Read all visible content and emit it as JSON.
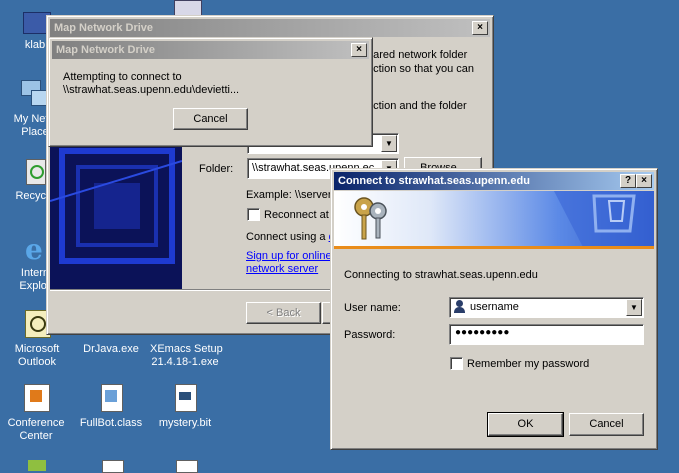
{
  "desktop": {
    "icons": [
      {
        "label": "klab"
      },
      {
        "label_line1": "My Netw",
        "label_line2": "Place"
      },
      {
        "label": "Recycle"
      },
      {
        "label_line1": "Intern",
        "label_line2": "Explor"
      },
      {
        "label_line1": "Microsoft",
        "label_line2": "Outlook"
      },
      {
        "label": "DrJava.exe"
      },
      {
        "label_line1": "XEmacs Setup",
        "label_line2": "21.4.18-1.exe"
      },
      {
        "label_line1": "Conference",
        "label_line2": "Center"
      },
      {
        "label": "FullBot.class"
      },
      {
        "label": "mystery.bit"
      }
    ]
  },
  "map_drive": {
    "title": "Map Network Drive",
    "intro_fragment_1": "hared network folder",
    "intro_fragment_2": "ection so that you can",
    "intro_fragment_3": "r.",
    "instruction_fragment": "ection and the folder",
    "folder_label": "Folder:",
    "folder_value": "\\\\strawhat.seas.upenn.ec",
    "browse_label": "Browse...",
    "example_text": "Example: \\\\server",
    "reconnect_label": "Reconnect at",
    "connect_using_text": "Connect using a ",
    "connect_using_link": "d",
    "signup_line1": "Sign up for online",
    "signup_line2": "network server",
    "back_label": "< Back"
  },
  "progress_dialog": {
    "title": "Map Network Drive",
    "line1": "Attempting to connect to",
    "line2": "\\\\strawhat.seas.upenn.edu\\devietti...",
    "cancel_label": "Cancel"
  },
  "connect_dialog": {
    "title": "Connect to strawhat.seas.upenn.edu",
    "help_label": "?",
    "close_label": "×",
    "connecting_text": "Connecting to strawhat.seas.upenn.edu",
    "username_label": "User name:",
    "username_value": "username",
    "password_label": "Password:",
    "password_value": "●●●●●●●●●",
    "remember_label": "Remember my password",
    "ok_label": "OK",
    "cancel_label": "Cancel"
  }
}
